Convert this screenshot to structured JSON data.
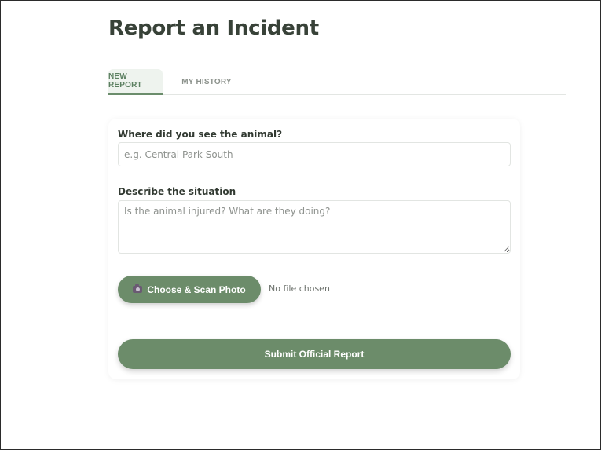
{
  "page": {
    "title": "Report an Incident"
  },
  "tabs": [
    {
      "label": "NEW REPORT",
      "active": true
    },
    {
      "label": "MY HISTORY",
      "active": false
    }
  ],
  "form": {
    "location_label": "Where did you see the animal?",
    "location_placeholder": "e.g. Central Park South",
    "location_value": "",
    "description_label": "Describe the situation",
    "description_placeholder": "Is the animal injured? What are they doing?",
    "description_value": "",
    "scan_button_label": "Choose & Scan Photo",
    "scan_button_icon": "camera-icon",
    "file_status": "No file chosen",
    "submit_label": "Submit Official Report"
  },
  "colors": {
    "accent": "#6c8c6a",
    "title": "#384238",
    "active_tab_bg": "#eef3ee",
    "active_tab_text": "#5c8061",
    "inactive_tab_text": "#8b918b"
  }
}
